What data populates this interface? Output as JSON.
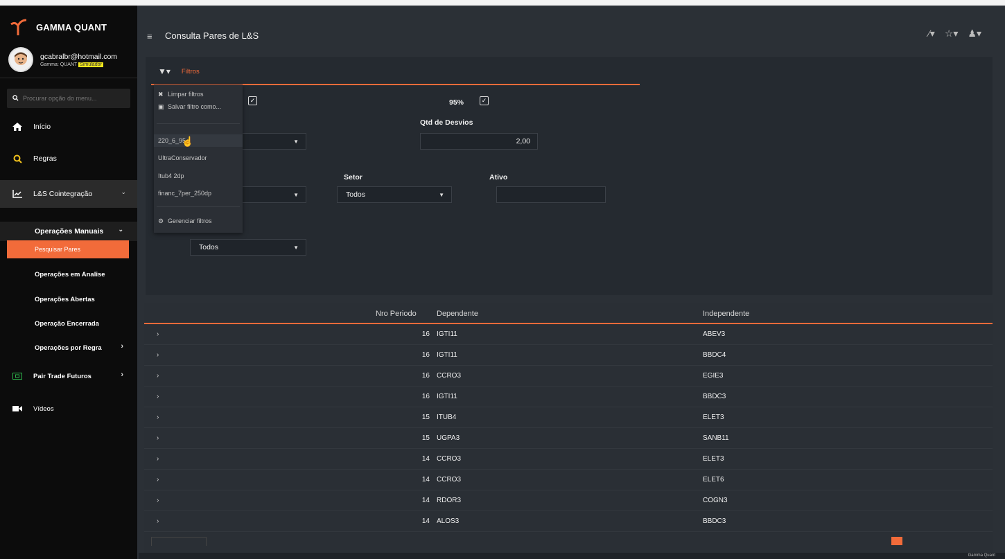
{
  "app": {
    "brand_name": "GAMMA QUANT",
    "user_email": "gcabralbr@hotmail.com",
    "user_plan_prefix": "Gamma: QUANT",
    "user_plan_badge": "Simulador",
    "accent_color": "#f26b3a"
  },
  "sidebar": {
    "search_placeholder": "Procurar opção do menu...",
    "items": [
      {
        "label": "Início",
        "icon": "home-icon"
      },
      {
        "label": "Regras",
        "icon": "search-icon"
      },
      {
        "label": "L&S Cointegração",
        "icon": "line-chart-icon"
      },
      {
        "label": "Operações Manuais",
        "icon": ""
      },
      {
        "label": "Pesquisar Pares",
        "icon": ""
      },
      {
        "label": "Operações em Analise",
        "icon": ""
      },
      {
        "label": "Operações Abertas",
        "icon": ""
      },
      {
        "label": "Operação Encerrada",
        "icon": ""
      },
      {
        "label": "Operações por Regra",
        "icon": ""
      },
      {
        "label": "Pair Trade Futuros",
        "icon": "futures-icon"
      },
      {
        "label": "Vídeos",
        "icon": "video-icon"
      }
    ]
  },
  "header": {
    "title": "Consulta Pares de L&S"
  },
  "filters": {
    "tab_label": "Filtros",
    "confidence_label": "95%",
    "qtd_desvios_label": "Qtd de Desvios",
    "qtd_desvios_value": "2,00",
    "setor_label": "Setor",
    "setor_value": "Todos",
    "ativo_label": "Ativo",
    "ativo_value": "",
    "extra_select_value": "Todos"
  },
  "dropdown": {
    "clear": "Limpar filtros",
    "save": "Salvar filtro como...",
    "saved": [
      "220_6_95",
      "UltraConservador",
      "Itub4 2dp",
      "financ_7per_250dp"
    ],
    "manage": "Gerenciar filtros"
  },
  "table": {
    "headers": [
      "Nro Periodo",
      "Dependente",
      "Independente"
    ],
    "rows": [
      {
        "periodo": "16",
        "dependente": "IGTI11",
        "independente": "ABEV3"
      },
      {
        "periodo": "16",
        "dependente": "IGTI11",
        "independente": "BBDC4"
      },
      {
        "periodo": "16",
        "dependente": "CCRO3",
        "independente": "EGIE3"
      },
      {
        "periodo": "16",
        "dependente": "IGTI11",
        "independente": "BBDC3"
      },
      {
        "periodo": "15",
        "dependente": "ITUB4",
        "independente": "ELET3"
      },
      {
        "periodo": "15",
        "dependente": "UGPA3",
        "independente": "SANB11"
      },
      {
        "periodo": "14",
        "dependente": "CCRO3",
        "independente": "ELET3"
      },
      {
        "periodo": "14",
        "dependente": "CCRO3",
        "independente": "ELET6"
      },
      {
        "periodo": "14",
        "dependente": "RDOR3",
        "independente": "COGN3"
      },
      {
        "periodo": "14",
        "dependente": "ALOS3",
        "independente": "BBDC3"
      }
    ]
  },
  "footer": {
    "text": "Gamma Quant"
  }
}
